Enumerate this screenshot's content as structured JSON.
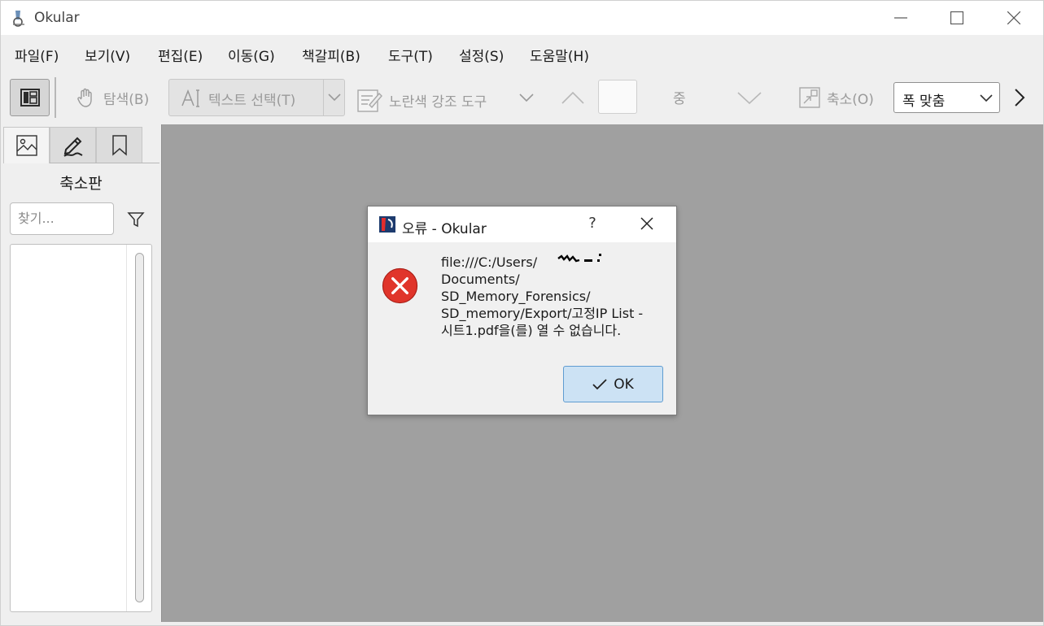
{
  "window": {
    "title": "Okular"
  },
  "menubar": {
    "items": [
      "파일(F)",
      "보기(V)",
      "편집(E)",
      "이동(G)",
      "책갈피(B)",
      "도구(T)",
      "설정(S)",
      "도움말(H)"
    ]
  },
  "toolbar": {
    "browse_label": "탐색(B)",
    "text_select_label": "텍스트 선택(T)",
    "highlighter_label": "노란색 강조 도구",
    "page_of_label": "중",
    "zoom_out_label": "축소(O)",
    "zoom_value": "폭 맞춤"
  },
  "sidebar": {
    "heading": "축소판",
    "search_placeholder": "찾기..."
  },
  "dialog": {
    "title": "오류 - Okular",
    "help": "?",
    "message": "file:///C:/Users/\nDocuments/\nSD_Memory_Forensics/\nSD_memory/Export/고정IP List -\n시트1.pdf을(를) 열 수 없습니다.",
    "ok_label": "OK"
  },
  "colors": {
    "main_bg": "#a0a0a0",
    "ok_button": "#cce2f4",
    "error_red": "#e0352b"
  }
}
